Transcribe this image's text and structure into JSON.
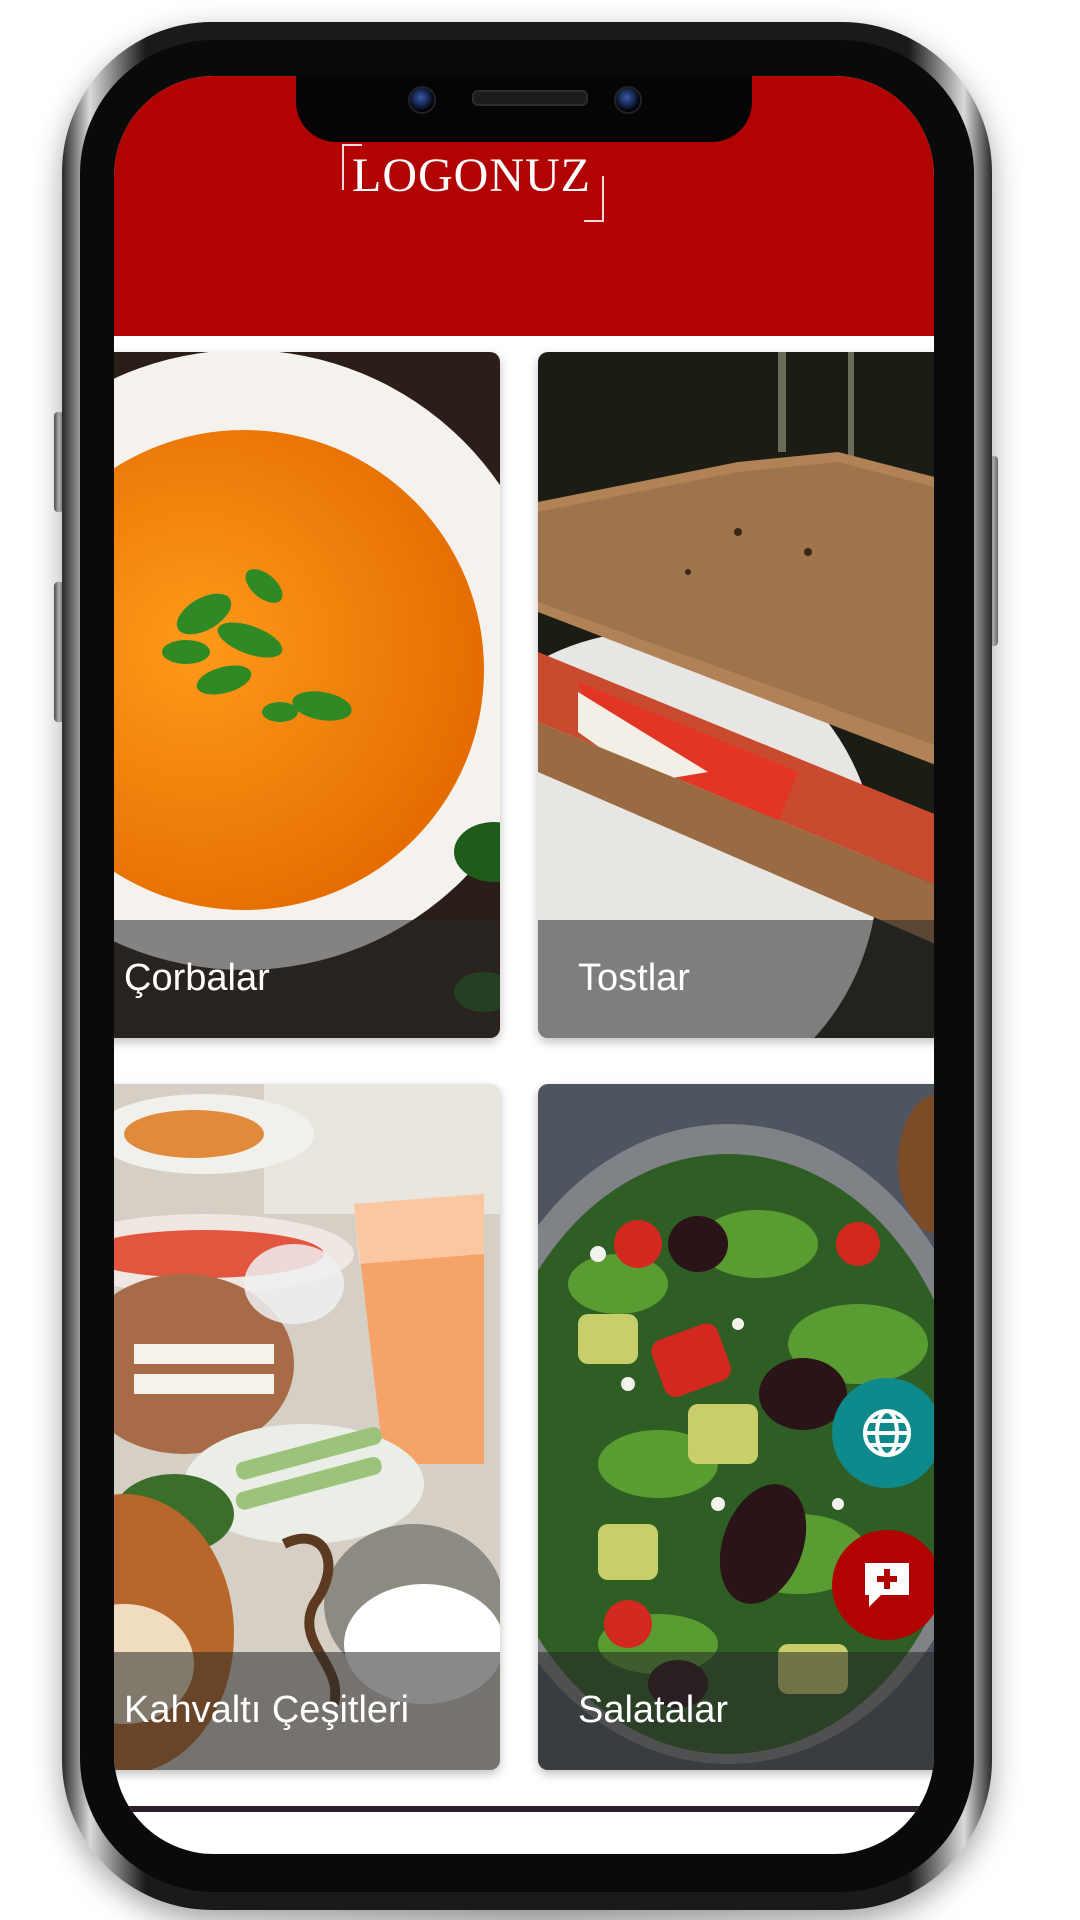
{
  "header": {
    "brand_color": "#b10402",
    "logo_text": "LOGONUZ"
  },
  "menu": {
    "categories": [
      {
        "label": "Çorbalar",
        "icon": "soup-photo"
      },
      {
        "label": "Tostlar",
        "icon": "toast-photo"
      },
      {
        "label": "Kahvaltı Çeşitleri",
        "icon": "breakfast-photo"
      },
      {
        "label": "Salatalar",
        "icon": "salad-photo"
      }
    ]
  },
  "actions": {
    "language_button": {
      "icon": "globe-icon",
      "color": "#0f8a8c"
    },
    "order_button": {
      "icon": "chat-plus-icon",
      "color": "#b10402"
    }
  }
}
